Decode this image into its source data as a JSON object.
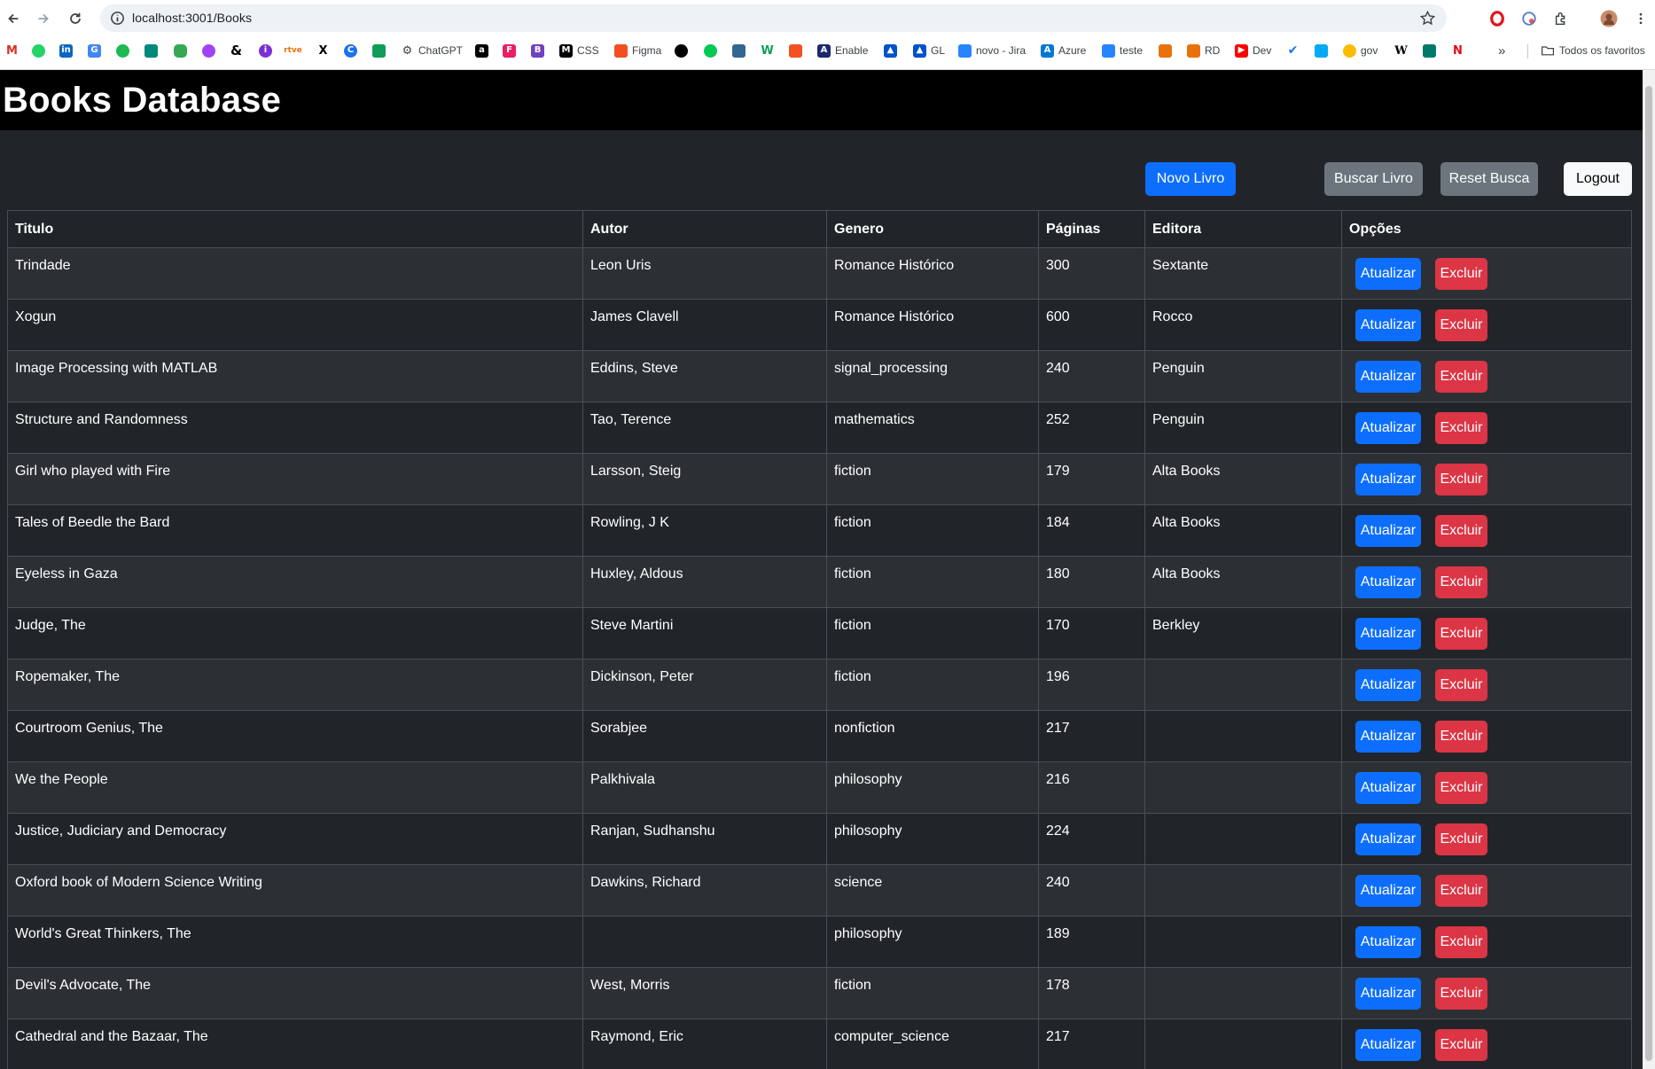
{
  "browser": {
    "url": "localhost:3001/Books",
    "bookmarks": [
      "ChatGPT",
      "CSS",
      "Figma",
      "Enable",
      "GL",
      "novo - Jira",
      "Azure",
      "teste",
      "RD",
      "Dev",
      "gov"
    ],
    "all_bookmarks": "Todos os favoritos",
    "more": "»"
  },
  "app": {
    "title": "Books Database",
    "buttons": {
      "new": "Novo Livro",
      "search": "Buscar Livro",
      "reset": "Reset Busca",
      "logout": "Logout"
    },
    "columns": [
      "Titulo",
      "Autor",
      "Genero",
      "Páginas",
      "Editora",
      "Opções"
    ],
    "row_actions": {
      "update": "Atualizar",
      "delete": "Excluir"
    },
    "books": [
      {
        "title": "Trindade",
        "author": "Leon Uris",
        "genre": "Romance Histórico",
        "pages": "300",
        "publisher": "Sextante"
      },
      {
        "title": "Xogun",
        "author": "James Clavell",
        "genre": "Romance Histórico",
        "pages": "600",
        "publisher": "Rocco"
      },
      {
        "title": "Image Processing with MATLAB",
        "author": "Eddins, Steve",
        "genre": "signal_processing",
        "pages": "240",
        "publisher": "Penguin"
      },
      {
        "title": "Structure and Randomness",
        "author": "Tao, Terence",
        "genre": "mathematics",
        "pages": "252",
        "publisher": "Penguin"
      },
      {
        "title": "Girl who played with Fire",
        "author": "Larsson, Steig",
        "genre": "fiction",
        "pages": "179",
        "publisher": "Alta Books"
      },
      {
        "title": "Tales of Beedle the Bard",
        "author": "Rowling, J K",
        "genre": "fiction",
        "pages": "184",
        "publisher": "Alta Books"
      },
      {
        "title": "Eyeless in Gaza",
        "author": "Huxley, Aldous",
        "genre": "fiction",
        "pages": "180",
        "publisher": "Alta Books"
      },
      {
        "title": "Judge, The",
        "author": "Steve Martini",
        "genre": "fiction",
        "pages": "170",
        "publisher": "Berkley"
      },
      {
        "title": "Ropemaker, The",
        "author": "Dickinson, Peter",
        "genre": "fiction",
        "pages": "196",
        "publisher": ""
      },
      {
        "title": "Courtroom Genius, The",
        "author": "Sorabjee",
        "genre": "nonfiction",
        "pages": "217",
        "publisher": ""
      },
      {
        "title": "We the People",
        "author": "Palkhivala",
        "genre": "philosophy",
        "pages": "216",
        "publisher": ""
      },
      {
        "title": "Justice, Judiciary and Democracy",
        "author": "Ranjan, Sudhanshu",
        "genre": "philosophy",
        "pages": "224",
        "publisher": ""
      },
      {
        "title": "Oxford book of Modern Science Writing",
        "author": "Dawkins, Richard",
        "genre": "science",
        "pages": "240",
        "publisher": ""
      },
      {
        "title": "World's Great Thinkers, The",
        "author": "",
        "genre": "philosophy",
        "pages": "189",
        "publisher": ""
      },
      {
        "title": "Devil's Advocate, The",
        "author": "West, Morris",
        "genre": "fiction",
        "pages": "178",
        "publisher": ""
      },
      {
        "title": "Cathedral and the Bazaar, The",
        "author": "Raymond, Eric",
        "genre": "computer_science",
        "pages": "217",
        "publisher": ""
      }
    ]
  },
  "colors": {
    "primary": "#0d6efd",
    "secondary": "#6c757d",
    "danger": "#dc3545",
    "header_bg": "#000000",
    "page_bg": "#212529"
  }
}
